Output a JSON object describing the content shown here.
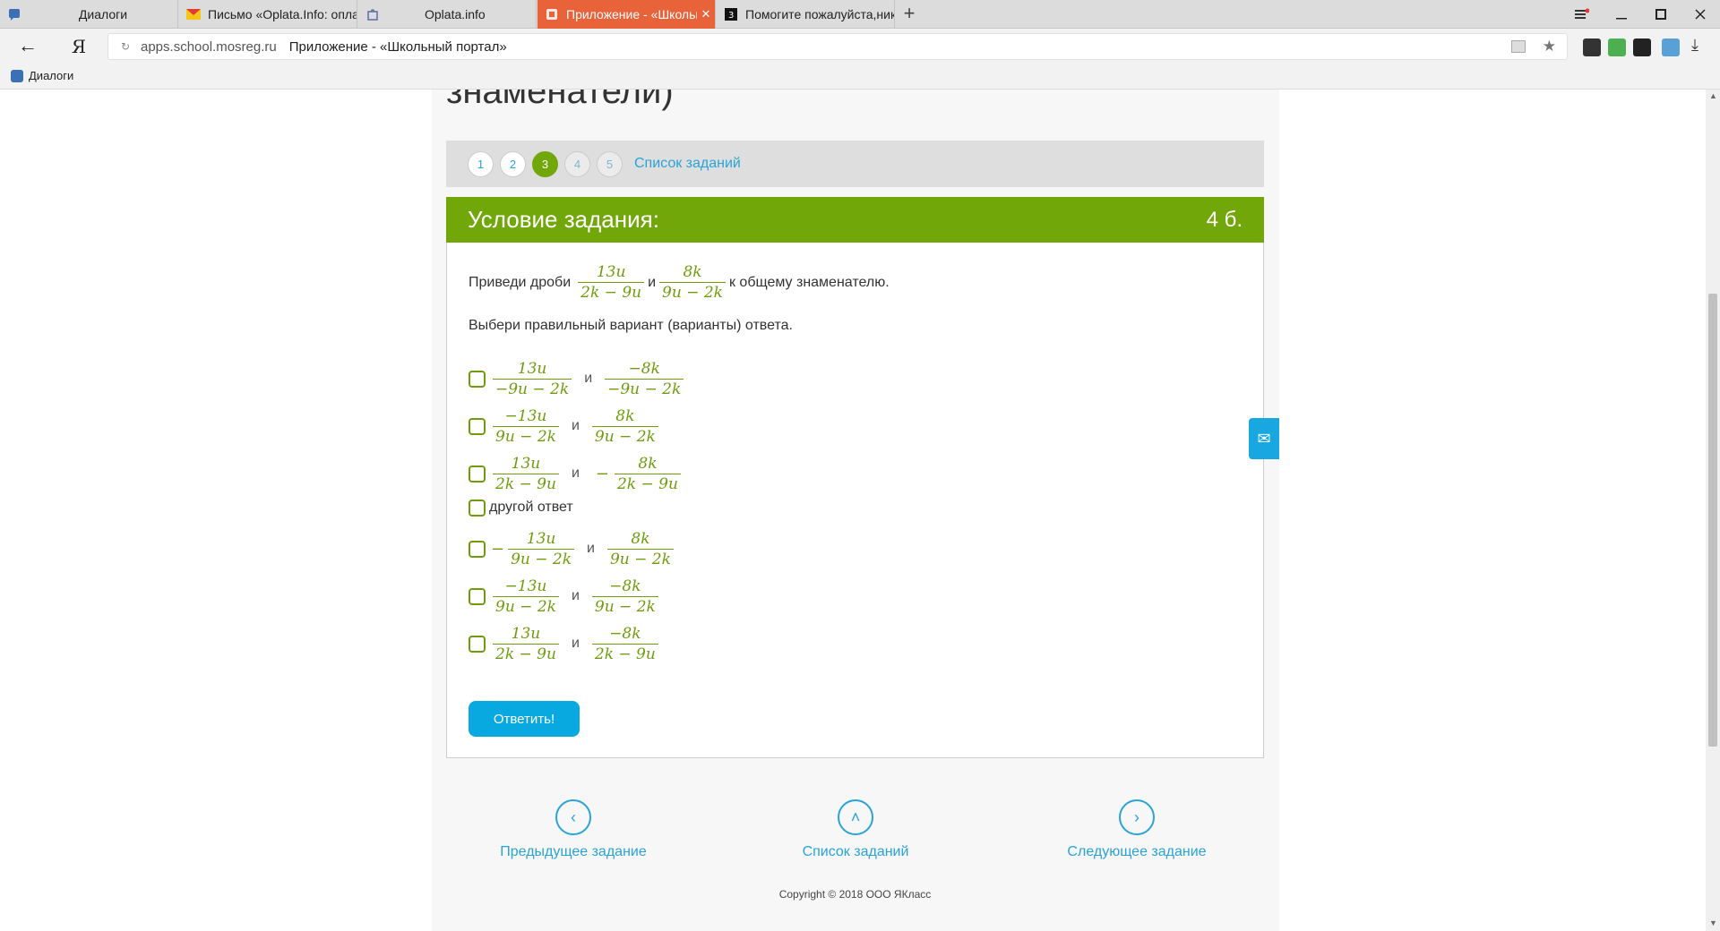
{
  "browser": {
    "tabs": [
      {
        "label": "Диалоги",
        "icon": "chat-icon",
        "active": false
      },
      {
        "label": "Письмо «Oplata.Info: оплат",
        "icon": "mail-icon",
        "active": false
      },
      {
        "label": "Oplata.info",
        "icon": "bag-icon",
        "active": false
      },
      {
        "label": "Приложение - «Школьн",
        "icon": "app-icon",
        "active": true
      },
      {
        "label": "Помогите пожалуйста,ника",
        "icon": "znanija-icon",
        "active": false
      }
    ],
    "new_tab_label": "+",
    "address": {
      "domain": "apps.school.mosreg.ru",
      "page_title": "Приложение - «Школьный портал»"
    },
    "bookmarks": [
      {
        "label": "Диалоги",
        "icon": "chat-icon"
      }
    ],
    "colors": {
      "active_tab": "#e8623a"
    }
  },
  "page": {
    "heading": "знаменатели)",
    "pager": {
      "numbers": [
        "1",
        "2",
        "3",
        "4",
        "5"
      ],
      "current": "3",
      "task_list_link": "Список заданий"
    },
    "condition": {
      "title": "Условие задания:",
      "points": "4 б."
    },
    "question": {
      "prefix": "Приведи дроби",
      "frac1": {
        "num": "13u",
        "den": "2k − 9u"
      },
      "conj": "и",
      "frac2": {
        "num": "8k",
        "den": "9u − 2k"
      },
      "suffix": "к общему знаменателю.",
      "instruction": "Выбери правильный вариант (варианты) ответа."
    },
    "options": [
      {
        "a": {
          "num": "13u",
          "den": "−9u − 2k"
        },
        "conj": "и",
        "b": {
          "num": "−8k",
          "den": "−9u − 2k"
        }
      },
      {
        "a": {
          "num": "−13u",
          "den": "9u − 2k"
        },
        "conj": "и",
        "b": {
          "num": "8k",
          "den": "9u − 2k"
        }
      },
      {
        "a": {
          "num": "13u",
          "den": "2k − 9u"
        },
        "conj": "и",
        "minus_b": "−",
        "b": {
          "num": "8k",
          "den": "2k − 9u"
        }
      },
      {
        "text": "другой ответ"
      },
      {
        "minus_a": "−",
        "a": {
          "num": "13u",
          "den": "9u − 2k"
        },
        "conj": "и",
        "b": {
          "num": "8k",
          "den": "9u − 2k"
        }
      },
      {
        "a": {
          "num": "−13u",
          "den": "9u − 2k"
        },
        "conj": "и",
        "b": {
          "num": "−8k",
          "den": "9u − 2k"
        }
      },
      {
        "a": {
          "num": "13u",
          "den": "2k − 9u"
        },
        "conj": "и",
        "b": {
          "num": "−8k",
          "den": "2k − 9u"
        }
      }
    ],
    "answer_button": "Ответить!",
    "nav": {
      "prev": "Предыдущее задание",
      "list": "Список заданий",
      "next": "Следующее задание"
    },
    "copyright": "Copyright © 2018 ООО ЯКласс",
    "colors": {
      "green": "#72a70a",
      "blue": "#08a8e0",
      "link": "#2aa3d8"
    }
  }
}
